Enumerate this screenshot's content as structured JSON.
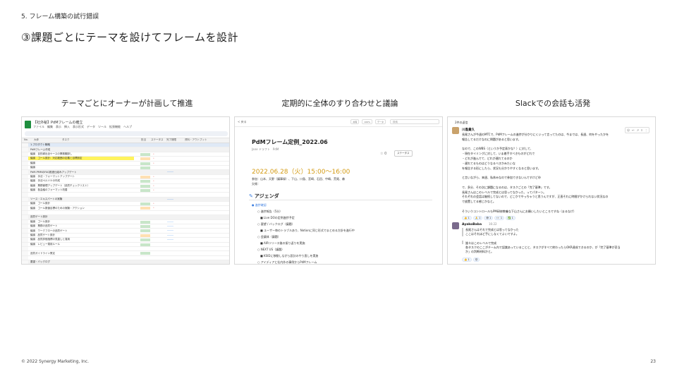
{
  "header": {
    "section": "5. フレーム構築の試行錯誤",
    "title": "③課題ごとにテーマを設けてフレームを設計"
  },
  "columns": [
    {
      "caption": "テーマごとにオーナーが計画して推進"
    },
    {
      "caption": "定期的に全体のすり合わせと議論"
    },
    {
      "caption": "Slackでの会話も活発"
    }
  ],
  "spreadsheet": {
    "title": "【社外秘】PdMフレームの確立",
    "menu": "ファイル　編集　表示　挿入　表示形式　データ　ツール　拡張機能　ヘルプ",
    "columns": [
      "No.",
      "大枠",
      "タスク",
      "担当",
      "ステータス",
      "完了期限",
      "資料・アウトプット"
    ],
    "rows": [
      {
        "text": "1.プロダクト戦略",
        "kind": "group"
      },
      {
        "text": "PdMフレーム作成",
        "kind": "sub"
      },
      {
        "text": "議論　目的導出全ケースの業務棚卸し",
        "status": "g",
        "late": true
      },
      {
        "text": "議論　ゴール設計：対応範囲の定義と目標設定",
        "kind": "hl",
        "status": "o",
        "late": true
      },
      {
        "text": "議論",
        "status": "g",
        "late": true
      },
      {
        "text": "議論",
        "status": "g"
      },
      {
        "text": "PdM-PMMのFAQ推進仕組みアップデート",
        "kind": "sub",
        "link": true
      },
      {
        "text": "議論　手法・フォーマットアップデート",
        "status": "o",
        "late": true
      },
      {
        "text": "議論　手法ペルソナの作成",
        "status": "g",
        "late": true
      },
      {
        "text": "議論　業務管理アップデート（品質チェックリスト）",
        "status": "g",
        "late": true
      },
      {
        "text": "議論　各会議のフォーマット改善",
        "status": "g",
        "late": true
      },
      {
        "text": "",
        "kind": "blank"
      },
      {
        "text": "ソース・エキスパートの実験",
        "kind": "sub",
        "link": true
      },
      {
        "text": "議論　ゴール設計",
        "status": "g",
        "late": true
      },
      {
        "text": "議論　ゴール数値目標のための実験・アクション",
        "status": "o",
        "late": true
      },
      {
        "text": "",
        "kind": "blank"
      },
      {
        "text": "品質ゲート設計",
        "kind": "sub"
      },
      {
        "text": "議論　ゴール設計",
        "status": "g",
        "link": true
      },
      {
        "text": "議論　業務の品質ゲート",
        "status": "g",
        "link": true
      },
      {
        "text": "議論　ワークフローの品質ゲート",
        "status": "g",
        "link": true
      },
      {
        "text": "議論　品質ゲート設計",
        "status": "o",
        "link": true
      },
      {
        "text": "議論　品質評価指標の見直しと運用",
        "status": "g",
        "link": true
      },
      {
        "text": "議論　レビュー運用ルール",
        "status": "g"
      },
      {
        "text": "",
        "kind": "blank"
      },
      {
        "text": "品質ガイドライン策定",
        "status": "g"
      },
      {
        "text": "",
        "kind": "blank"
      },
      {
        "text": "要望・バックログ",
        "kind": "sub"
      },
      {
        "text": "議論　要望整理",
        "status": "g",
        "link": true
      },
      {
        "text": "議論　要望管理の整理",
        "status": "g",
        "link": true
      },
      {
        "text": "議論　優先度評価と判断ルール",
        "status": "g"
      },
      {
        "text": "議論　バックログ運用",
        "status": "g"
      },
      {
        "text": "議論　要望管理の整理",
        "status": "g"
      },
      {
        "text": "議論　要望管理の整理",
        "status": "g"
      }
    ]
  },
  "doc": {
    "back": "< 戻る",
    "tools": [
      "共有",
      "100%",
      "データ"
    ],
    "search": "検索",
    "title": "PdMフレーム定例_2022.06",
    "meta": "Jane ドラフト　PdM",
    "stars": "☆ 0",
    "subscribe": "ステータス",
    "date": "2022.06.28（火）15:00〜16:00",
    "attendees": "参加：山本、天野（議事録）、下山、川島、宮崎、石田、中嶋、荒尾、森",
    "absent": "欠席：",
    "agenda": "アジェンダ",
    "items": [
      {
        "text": "● 進捗確認",
        "link": true
      },
      {
        "text": "　　○ 進捗報告（5分）"
      },
      {
        "text": "　　　■ Live DOの定例進捗予定"
      },
      {
        "text": "　　○ 要望 / バックログ（議題）"
      },
      {
        "text": "　　　■ ユーザー毎のトラブルあり、Notionに同じ形式でまとめる方針を進行中"
      },
      {
        "text": "　　○ 会議体（議題）"
      },
      {
        "text": "　　　■ AIRリリース後の振り返りを実施"
      },
      {
        "text": "　　○ NEXT US（議題）"
      },
      {
        "text": "　　　■ KSIDに移動しながら設計のやり直しを実施"
      },
      {
        "text": "　　○ アイディアと社内外の事例からPdMフレーム"
      }
    ]
  },
  "slack": {
    "thread": "2件の返信",
    "author1": "川島貴久",
    "msg1": [
      "長尾さんが今週のMTCで、PdMフレームの進捗が分かりにくいって言ってたのは、今までは、長週、何をやったかを",
      "報告してるだけなのに問題があると思います。",
      "",
      "なので、このWBS（というか予定表かな？）に対して、",
      "・現在タイミングに対して、いま着手すべきものがどれで",
      "・どれが進んでて、どれが遅れてるのか",
      "・遅れてるものはどうなるべきかみたいな",
      "を報告する形にしたら、状況も分かりやすくなると思います。",
      "",
      "と言いながら、来週、私休みなので参加できないんですけど😅",
      "",
      "で、多分、その次に課題になるのは、タスクごとの「完了基準」です。",
      "長尾さんはこのレベルで完成とは思ってなかった、ってパターン。",
      "それぞれの会話は継続してないので、どこかでやっちゃうと思うんですが、正直それに時間がかけられない状況なの",
      "で放置してる感じかなと。",
      "",
      "そういうコントロールもPM研修教養な下山さんにお願いしたいところですね（まるなげ）"
    ],
    "author2": "AyakoBaba",
    "time2": "16:22",
    "msg2": [
      "長尾さんはそれで完成とは思ってなかった",
      "ここはそれほど手にしなくてよいですよ。",
      "",
      "誰々はこのレベルで完成",
      "各タスクのここがチーム内で認識あっていることと、タスクがすべて終わったらOKR達成できるのか、が「完了基準が妥当",
      "か」の判断材料かと。"
    ]
  },
  "footer": {
    "copyright": "© 2022 Synergy Marketing, Inc.",
    "page": "23"
  }
}
